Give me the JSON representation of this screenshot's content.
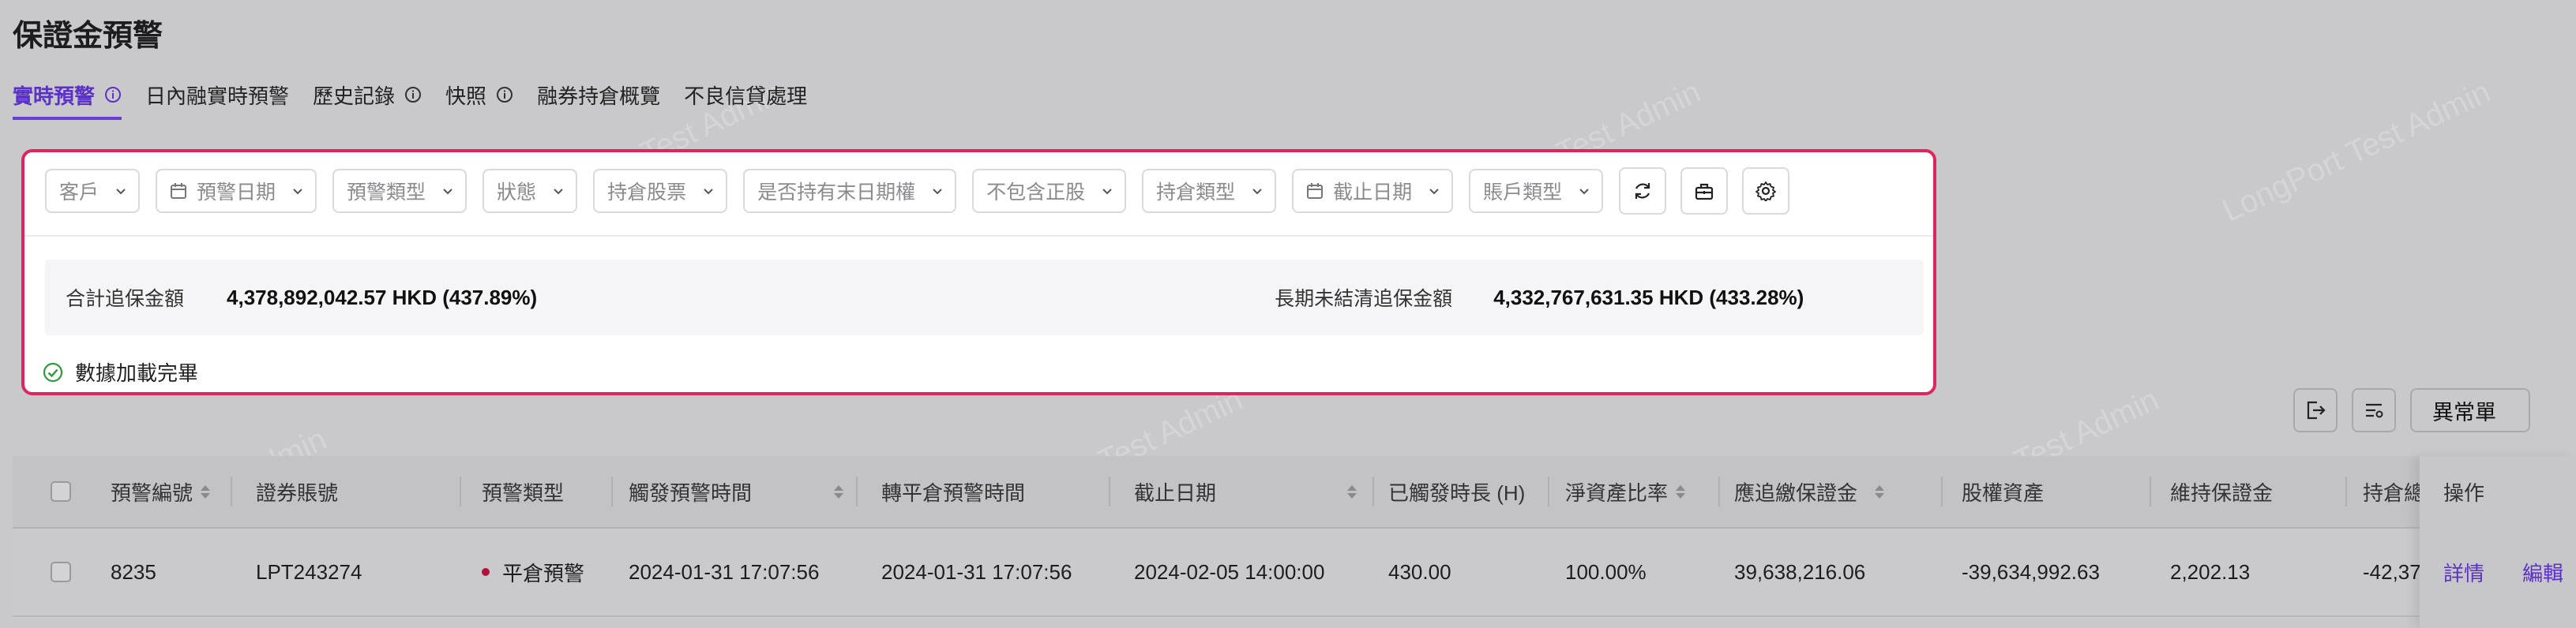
{
  "page": {
    "title": "保證金預警"
  },
  "tabs": [
    {
      "label": "實時預警",
      "info": true
    },
    {
      "label": "日內融實時預警",
      "info": false
    },
    {
      "label": "歷史記錄",
      "info": true
    },
    {
      "label": "快照",
      "info": true
    },
    {
      "label": "融券持倉概覽",
      "info": false
    },
    {
      "label": "不良信貸處理",
      "info": false
    }
  ],
  "filters": {
    "customer": "客戶",
    "alert_date": "預警日期",
    "alert_type": "預警類型",
    "status": "狀態",
    "holding_stock": "持倉股票",
    "has_expiring_rights": "是否持有末日期權",
    "exclude_positive": "不包含正股",
    "holding_type": "持倉類型",
    "cutoff_date": "截止日期",
    "account_type": "賬戶類型"
  },
  "summary": {
    "total_label": "合計追保金額",
    "total_value": "4,378,892,042.57 HKD (437.89%)",
    "long_label": "長期未結清追保金額",
    "long_value": "4,332,767,631.35 HKD (433.28%)"
  },
  "status": {
    "text": "數據加載完畢"
  },
  "toolbar": {
    "abnormal_label": "異常單"
  },
  "table": {
    "columns": [
      "預警編號",
      "證券賬號",
      "預警類型",
      "觸發預警時間",
      "轉平倉預警時間",
      "截止日期",
      "已觸發時長 (H)",
      "淨資產比率",
      "應追繳保證金",
      "股權資產",
      "維持保證金",
      "持倉總",
      "操作"
    ],
    "rows": [
      {
        "id": "8235",
        "account": "LPT243274",
        "type": "平倉預警",
        "trigger_time": "2024-01-31 17:07:56",
        "close_time": "2024-01-31 17:07:56",
        "deadline": "2024-02-05 14:00:00",
        "duration": "430.00",
        "ratio": "100.00%",
        "margin_call": "39,638,216.06",
        "equity": "-39,634,992.63",
        "maintenance": "2,202.13",
        "position_total": "-42,37",
        "detail": "詳情",
        "edit": "編輯"
      }
    ]
  },
  "watermark": "LongPort Test Admin",
  "colors": {
    "accent": "#5b32c7",
    "highlight_border": "#e0245e",
    "success": "#2e9b3a",
    "alert_dot": "#b0123c"
  }
}
